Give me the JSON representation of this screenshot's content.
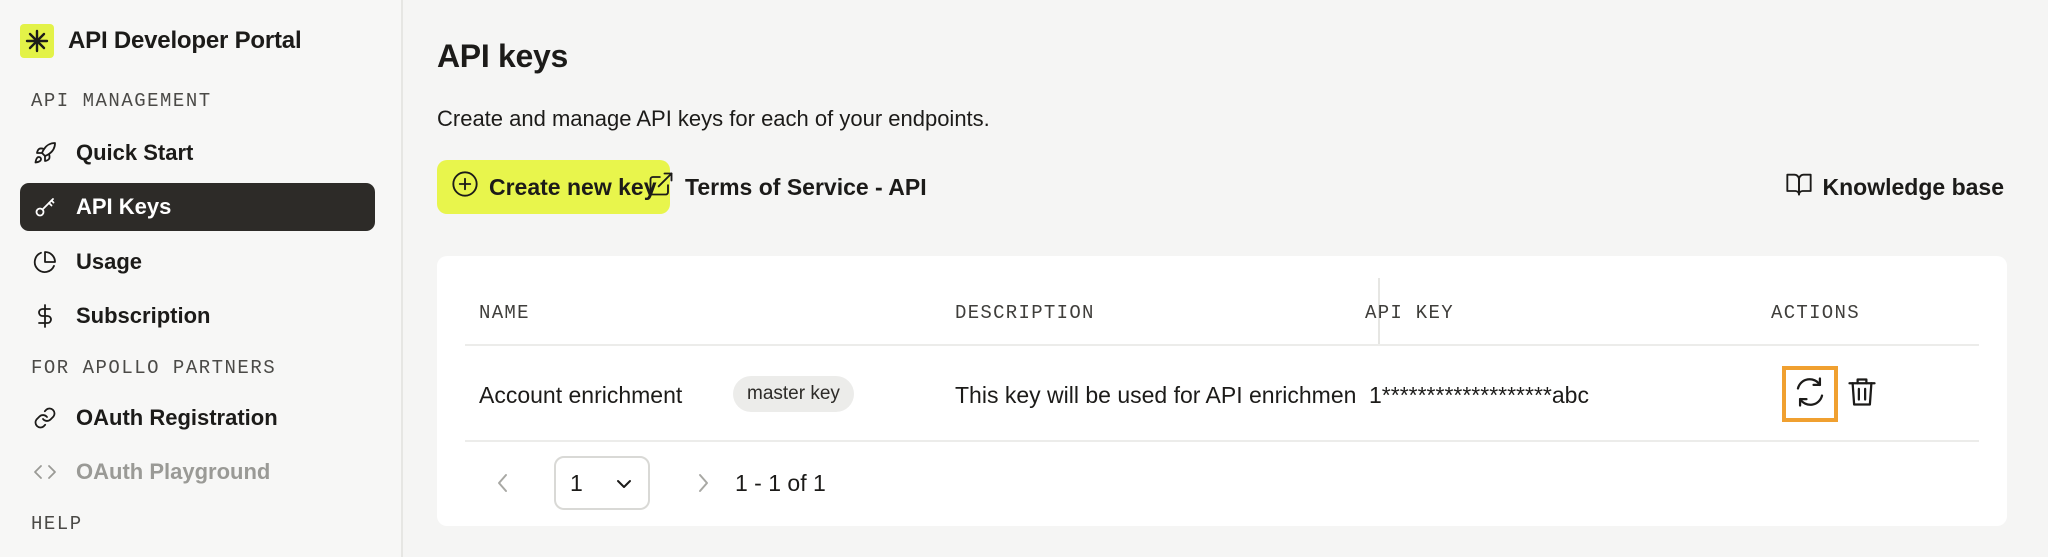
{
  "app": {
    "name": "API Developer Portal",
    "accent": "#e8f54c"
  },
  "sidebar": {
    "sections": [
      {
        "label": "API MANAGEMENT",
        "items": [
          {
            "label": "Quick Start",
            "icon": "rocket-icon",
            "active": false
          },
          {
            "label": "API Keys",
            "icon": "key-icon",
            "active": true
          },
          {
            "label": "Usage",
            "icon": "pie-chart-icon",
            "active": false
          },
          {
            "label": "Subscription",
            "icon": "dollar-icon",
            "active": false
          }
        ]
      },
      {
        "label": "FOR APOLLO PARTNERS",
        "items": [
          {
            "label": "OAuth Registration",
            "icon": "link-icon",
            "active": false
          },
          {
            "label": "OAuth Playground",
            "icon": "code-icon",
            "active": false,
            "disabled": true
          }
        ]
      },
      {
        "label": "HELP",
        "items": []
      }
    ]
  },
  "main": {
    "title": "API keys",
    "subtitle": "Create and manage API keys for each of your endpoints.",
    "create_button": "Create new key",
    "tos_link": "Terms of Service - API",
    "kb_link": "Knowledge base"
  },
  "table": {
    "columns": [
      "NAME",
      "DESCRIPTION",
      "API KEY",
      "ACTIONS"
    ],
    "rows": [
      {
        "name": "Account enrichment",
        "badge": "master key",
        "description": "This key will be used for API enrichment",
        "api_key": "1*******************abc",
        "actions": [
          "rotate-icon",
          "trash-icon"
        ]
      }
    ]
  },
  "pagination": {
    "page": "1",
    "range": "1 - 1 of 1"
  }
}
